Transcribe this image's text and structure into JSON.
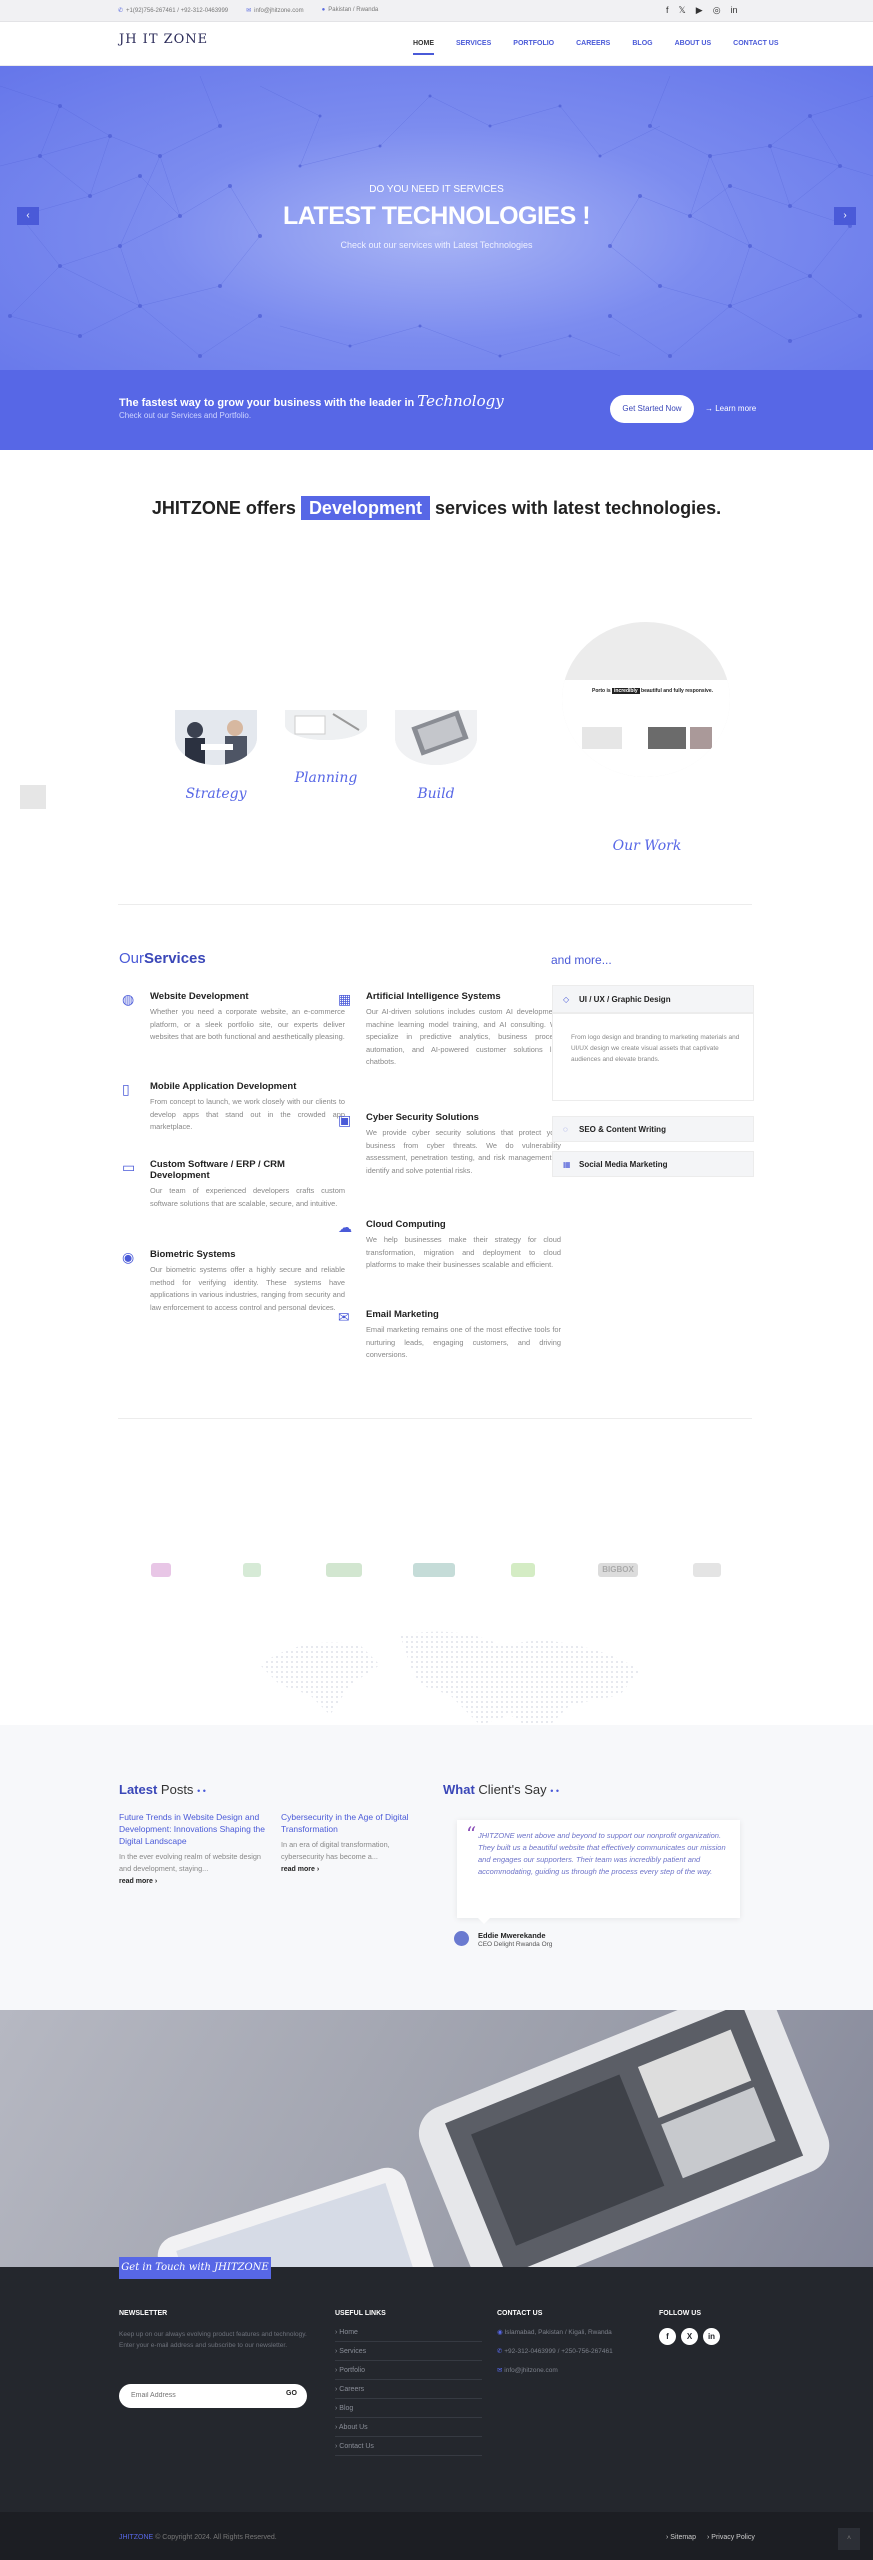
{
  "topbar": {
    "phone": "+1(92)756-267461 / +92-312-0463999",
    "email": "info@jhitzone.com",
    "location": "Pakistan / Rwanda",
    "socials": [
      "facebook-icon",
      "x-icon",
      "youtube-icon",
      "instagram-icon",
      "linkedin-icon"
    ]
  },
  "header": {
    "logo": "JH IT ZONE",
    "logo_tag": "",
    "nav": [
      "HOME",
      "SERVICES",
      "PORTFOLIO",
      "CAREERS",
      "BLOG",
      "ABOUT US",
      "CONTACT US"
    ]
  },
  "hero": {
    "pre": "DO YOU NEED IT SERVICES",
    "title": "LATEST TECHNOLOGIES !",
    "subtitle": "Check out our services with Latest Technologies",
    "prev": "‹",
    "next": "›"
  },
  "cta": {
    "title": "The fastest way to grow your business with the leader in",
    "title_hand": "Technology",
    "subtitle": "Check out our Services and Portfolio.",
    "button": "Get Started Now",
    "learn_more": "Learn more"
  },
  "offers": {
    "before": "JHITZONE offers",
    "highlight": "Development",
    "after": "services with latest technologies."
  },
  "process": {
    "labels": [
      "Strategy",
      "Planning",
      "Build",
      "Our Work"
    ],
    "work_preview_heading_a": "Porto is",
    "work_preview_highlight": "incredibly",
    "work_preview_heading_b": "beautiful and fully responsive."
  },
  "services": {
    "title_a": "Our",
    "title_b": "Services",
    "left": [
      {
        "icon": "globe-icon",
        "title": "Website Development",
        "text": "Whether you need a corporate website, an e-commerce platform, or a sleek portfolio site, our experts deliver websites that are both functional and aesthetically pleasing."
      },
      {
        "icon": "mobile-icon",
        "title": "Mobile Application Development",
        "text": "From concept to launch, we work closely with our clients to develop apps that stand out in the crowded app marketplace."
      },
      {
        "icon": "clipboard-icon",
        "title": "Custom Software / ERP / CRM Development",
        "text": "Our team of experienced developers crafts custom software solutions that are scalable, secure, and intuitive."
      },
      {
        "icon": "fingerprint-icon",
        "title": "Biometric Systems",
        "text": "Our biometric systems offer a highly secure and reliable method for verifying identity. These systems have applications in various industries, ranging from security and law enforcement to access control and personal devices."
      }
    ],
    "right": [
      {
        "icon": "grid-icon",
        "title": "Artificial Intelligence Systems",
        "text": "Our AI-driven solutions includes custom AI development, machine learning model training, and AI consulting. We specialize in predictive analytics, business process automation, and AI-powered customer solutions like chatbots."
      },
      {
        "icon": "shield-card-icon",
        "title": "Cyber Security Solutions",
        "text": "We provide cyber security solutions that protect your business from cyber threats. We do vulnerability assessment, penetration testing, and risk management to identify and solve potential risks."
      },
      {
        "icon": "cloud-icon",
        "title": "Cloud Computing",
        "text": "We help businesses make their strategy for cloud transformation, migration and deployment to cloud platforms to make their businesses scalable and efficient."
      },
      {
        "icon": "envelope-icon",
        "title": "Email Marketing",
        "text": "Email marketing remains one of the most effective tools for nurturing leads, engaging customers, and driving conversions."
      }
    ]
  },
  "more": {
    "title": "and more...",
    "cards": [
      {
        "icon": "diamond-icon",
        "title": "UI / UX / Graphic Design",
        "text": "From logo design and branding to marketing materials and UI/UX design we create visual assets that captivate audiences and elevate brands."
      },
      {
        "icon": "chat-icon",
        "title": "SEO & Content Writing"
      },
      {
        "icon": "squares-icon",
        "title": "Social Media Marketing"
      }
    ]
  },
  "clients": {
    "logos": [
      "client-logo-1",
      "client-logo-2",
      "client-logo-3",
      "client-logo-4",
      "client-logo-5",
      "client-logo-6",
      "client-logo-7"
    ],
    "logo_text": "BIGBOX"
  },
  "posts": {
    "title_a": "Latest",
    "title_b": "Posts",
    "items": [
      {
        "title": "Future Trends in Website Design and Development: Innovations Shaping the Digital Landscape",
        "excerpt": "In the ever evolving realm of website design and development, staying...",
        "read_more": "read more"
      },
      {
        "title": "Cybersecurity in the Age of Digital Transformation",
        "excerpt": "In an era of digital transformation, cybersecurity has become a...",
        "read_more": "read more"
      }
    ]
  },
  "testimonials": {
    "title_a": "What",
    "title_b": "Client's Say",
    "quote": "JHITZONE went above and beyond to support our nonprofit organization. They built us a beautiful website that effectively communicates our mission and engages our supporters. Their team was incredibly patient and accommodating, guiding us through the process every step of the way.",
    "name": "Eddie Mwerekande",
    "role": "CEO Delight Rwanda Org"
  },
  "contact_tab": "Get in Touch with JHITZONE",
  "footer": {
    "newsletter_title": "NEWSLETTER",
    "newsletter_text": "Keep up on our always evolving product features and technology. Enter your e-mail address and subscribe to our newsletter.",
    "email_placeholder": "Email Address",
    "go": "GO",
    "links_title": "USEFUL LINKS",
    "links": [
      "Home",
      "Services",
      "Portfolio",
      "Careers",
      "Blog",
      "About Us",
      "Contact Us"
    ],
    "contact_title": "CONTACT US",
    "address": "Islamabad, Pakistan / Kigali, Rwanda",
    "phone": "+92-312-0463999 / +250-756-267461",
    "email": "info@jhitzone.com",
    "follow_title": "FOLLOW US",
    "follow": [
      "f",
      "X",
      "in"
    ]
  },
  "bottom": {
    "brand": "JHITZONE",
    "copyright": "© Copyright 2024. All Rights Reserved.",
    "links": [
      "Sitemap",
      "Privacy Policy"
    ]
  },
  "colors": {
    "primary": "#5767e6",
    "primary_dark": "#3a47b8",
    "footer_bg": "#24272d"
  }
}
